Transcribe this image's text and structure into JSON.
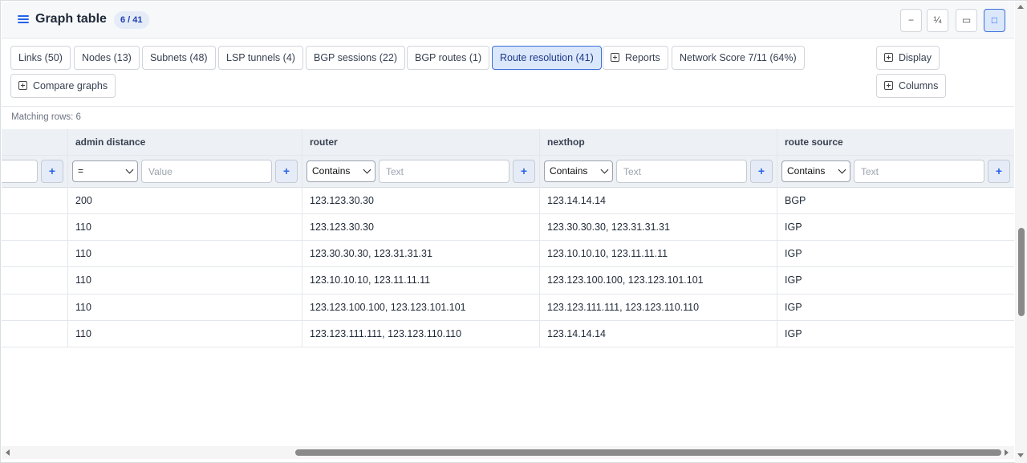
{
  "header": {
    "title": "Graph table",
    "badge": "6 / 41",
    "window_buttons": [
      {
        "name": "minimize",
        "label": "−"
      },
      {
        "name": "quarter",
        "label": "¼"
      },
      {
        "name": "half",
        "label": "▭"
      },
      {
        "name": "full",
        "label": "□"
      }
    ]
  },
  "tabs": [
    {
      "label": "Links (50)"
    },
    {
      "label": "Nodes (13)"
    },
    {
      "label": "Subnets (48)"
    },
    {
      "label": "LSP tunnels (4)"
    },
    {
      "label": "BGP sessions (22)"
    },
    {
      "label": "BGP routes (1)"
    },
    {
      "label": "Route resolution (41)",
      "active": true
    },
    {
      "label": "Reports"
    },
    {
      "label": "Network Score 7/11 (64%)"
    },
    {
      "label": "Compare graphs"
    }
  ],
  "side_buttons": {
    "display": "Display",
    "columns": "Columns"
  },
  "matching_rows": "Matching rows: 6",
  "table": {
    "columns": [
      "admin distance",
      "router",
      "nexthop",
      "route source"
    ],
    "filters": [
      {
        "operator": "=",
        "placeholder": "Value"
      },
      {
        "operator": "Contains",
        "placeholder": "Text"
      },
      {
        "operator": "Contains",
        "placeholder": "Text"
      },
      {
        "operator": "Contains",
        "placeholder": "Text"
      }
    ],
    "rows": [
      [
        "200",
        "123.123.30.30",
        "123.14.14.14",
        "BGP"
      ],
      [
        "110",
        "123.123.30.30",
        "123.30.30.30, 123.31.31.31",
        "IGP"
      ],
      [
        "110",
        "123.30.30.30, 123.31.31.31",
        "123.10.10.10, 123.11.11.11",
        "IGP"
      ],
      [
        "110",
        "123.10.10.10, 123.11.11.11",
        "123.123.100.100, 123.123.101.101",
        "IGP"
      ],
      [
        "110",
        "123.123.100.100, 123.123.101.101",
        "123.123.111.111, 123.123.110.110",
        "IGP"
      ],
      [
        "110",
        "123.123.111.111, 123.123.110.110",
        "123.14.14.14",
        "IGP"
      ]
    ]
  },
  "colors": {
    "accent": "#2563eb",
    "active_tab_bg": "#dbe7fb",
    "header_bg": "#f6f8fa"
  }
}
